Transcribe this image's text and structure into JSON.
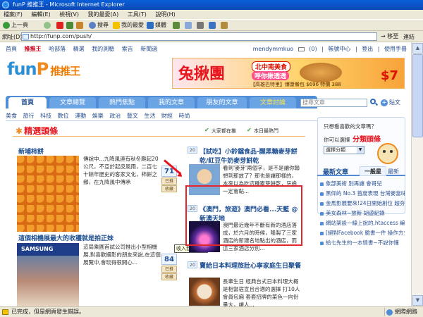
{
  "window": {
    "title": "funP 推推王 - Microsoft Internet Explorer"
  },
  "menu": [
    "檔案(F)",
    "編輯(E)",
    "檢視(V)",
    "我的最愛(A)",
    "工具(T)",
    "說明(H)"
  ],
  "toolbar": {
    "back": "上一頁",
    "search": "搜尋",
    "favorites": "我的最愛",
    "media": "媒體"
  },
  "address": {
    "label": "網址(D)",
    "url": "http://funp.com/push/",
    "go": "移至",
    "links": "連結"
  },
  "site": {
    "topnav": [
      "首頁",
      "推推王",
      "哈部落",
      "精選",
      "我的測驗",
      "索吉",
      "新聞過"
    ],
    "topnav_active": 1,
    "user": {
      "name": "mendymmkuo",
      "count": "(0)",
      "links": [
        "帳號中心",
        "登出",
        "使用手冊"
      ]
    },
    "logo": {
      "main": "fun",
      "p": "P",
      "cn": "推推王"
    },
    "banner": {
      "big": "兔揪團",
      "pill1": "北中南美食",
      "pill2": "呼你揪透透",
      "bottom": "【高雄巴特里】爆漿餐包 $696 特價 388",
      "price": "$7"
    }
  },
  "tabs": [
    {
      "label": "首頁",
      "active": true,
      "hot": false
    },
    {
      "label": "文章總覽",
      "active": false,
      "hot": false
    },
    {
      "label": "熱門焦點",
      "active": false,
      "hot": false
    },
    {
      "label": "我的文章",
      "active": false,
      "hot": false
    },
    {
      "label": "朋友的文章",
      "active": false,
      "hot": false
    },
    {
      "label": "文章討論",
      "active": false,
      "hot": true
    }
  ],
  "search": {
    "placeholder": "搜尋文章",
    "join": "貼文"
  },
  "subcats": [
    "美食",
    "旅行",
    "科技",
    "數位",
    "運動",
    "娛樂",
    "政治",
    "藝文",
    "生活",
    "財經",
    "時尚"
  ],
  "featured": {
    "title": "精選頭條",
    "sort": [
      "大家都在推",
      "本日最熱門"
    ]
  },
  "articles_left": [
    {
      "title": "新埔柿餅",
      "desc": "傳說中...九降風連有秋冬颳起20公尺，不亞於起皮風雨，二百七十餘年歷史的客家文化，柿餅之鄉，在九降風中傳承",
      "votes": "71",
      "vote_btn": "已推",
      "save_btn": "收藏"
    },
    {
      "title": "這個相機展最大的收穫就是拍正妹",
      "desc": "這局乘圓首試公司推出小型相機展,對喜歡攝影的朋友來說,在這個展覽中,會玩得很開心...",
      "votes": "84",
      "vote_btn": "已推",
      "save_btn": "收藏"
    }
  ],
  "articles_mid": [
    {
      "num": "20",
      "title": "【試吃】小鈴鐺食品-醒黑糖麥芽餅乾/紅豆牛奶麥芽餅乾",
      "desc": "看到'麥芽'兩個字，是不是讓你聯想到那放了？那也是讓那樣的，本來以為吃這種麥芽餅乾，牙齒一定會黏..."
    },
    {
      "num": "20",
      "title": "《澳門，旅遊》澳門必看...天藍 @新澳天地",
      "desc": "澳門最近幾年不斷有新的酒店落成，於六月的時候，隆製了三家酒店的新建名地點出的酒店，而這三家酒店分別..."
    },
    {
      "num": "20",
      "title": "賣給日本料理旅壯心寧家庭生日聚餐",
      "desc": "長輩生日 經典台式日本料理大概是相當宿宣且合適的選擇 打10人會員包廂 套套招牌的菜色一向份量大，讓人..."
    }
  ],
  "tooltip": "收入我的最愛",
  "sidebar": {
    "question": "只想看喜歡的文章嗎？",
    "cta": "分類頭條",
    "cta_prefix": "你可以選擇",
    "select": "選擇分類",
    "tabs": {
      "h1": "最新文章",
      "h2": "一般星",
      "h3": "最新"
    },
    "items": [
      "象部美術 別再讓 會哥兒",
      "黑仰的 No.3 首度表現 台灣麥當味程式與入龍 棋王審查",
      "金馬影展要來!24日開始創位 超夯熱門片搶先看",
      "美女森林~放新 胡遊紀錄",
      "網站架設一線上說的,htaccess 編輯器 ! 4模板 分類管理【Mimet】",
      "[絕對Facebook 臉書一件 操作方式與教學效果的 ...]月光下的驚鳴",
      "給七先生的一本情書~不說你懂"
    ]
  },
  "status": {
    "text": "已完成，但是網頁發生錯誤。",
    "zone": "網際網路"
  }
}
